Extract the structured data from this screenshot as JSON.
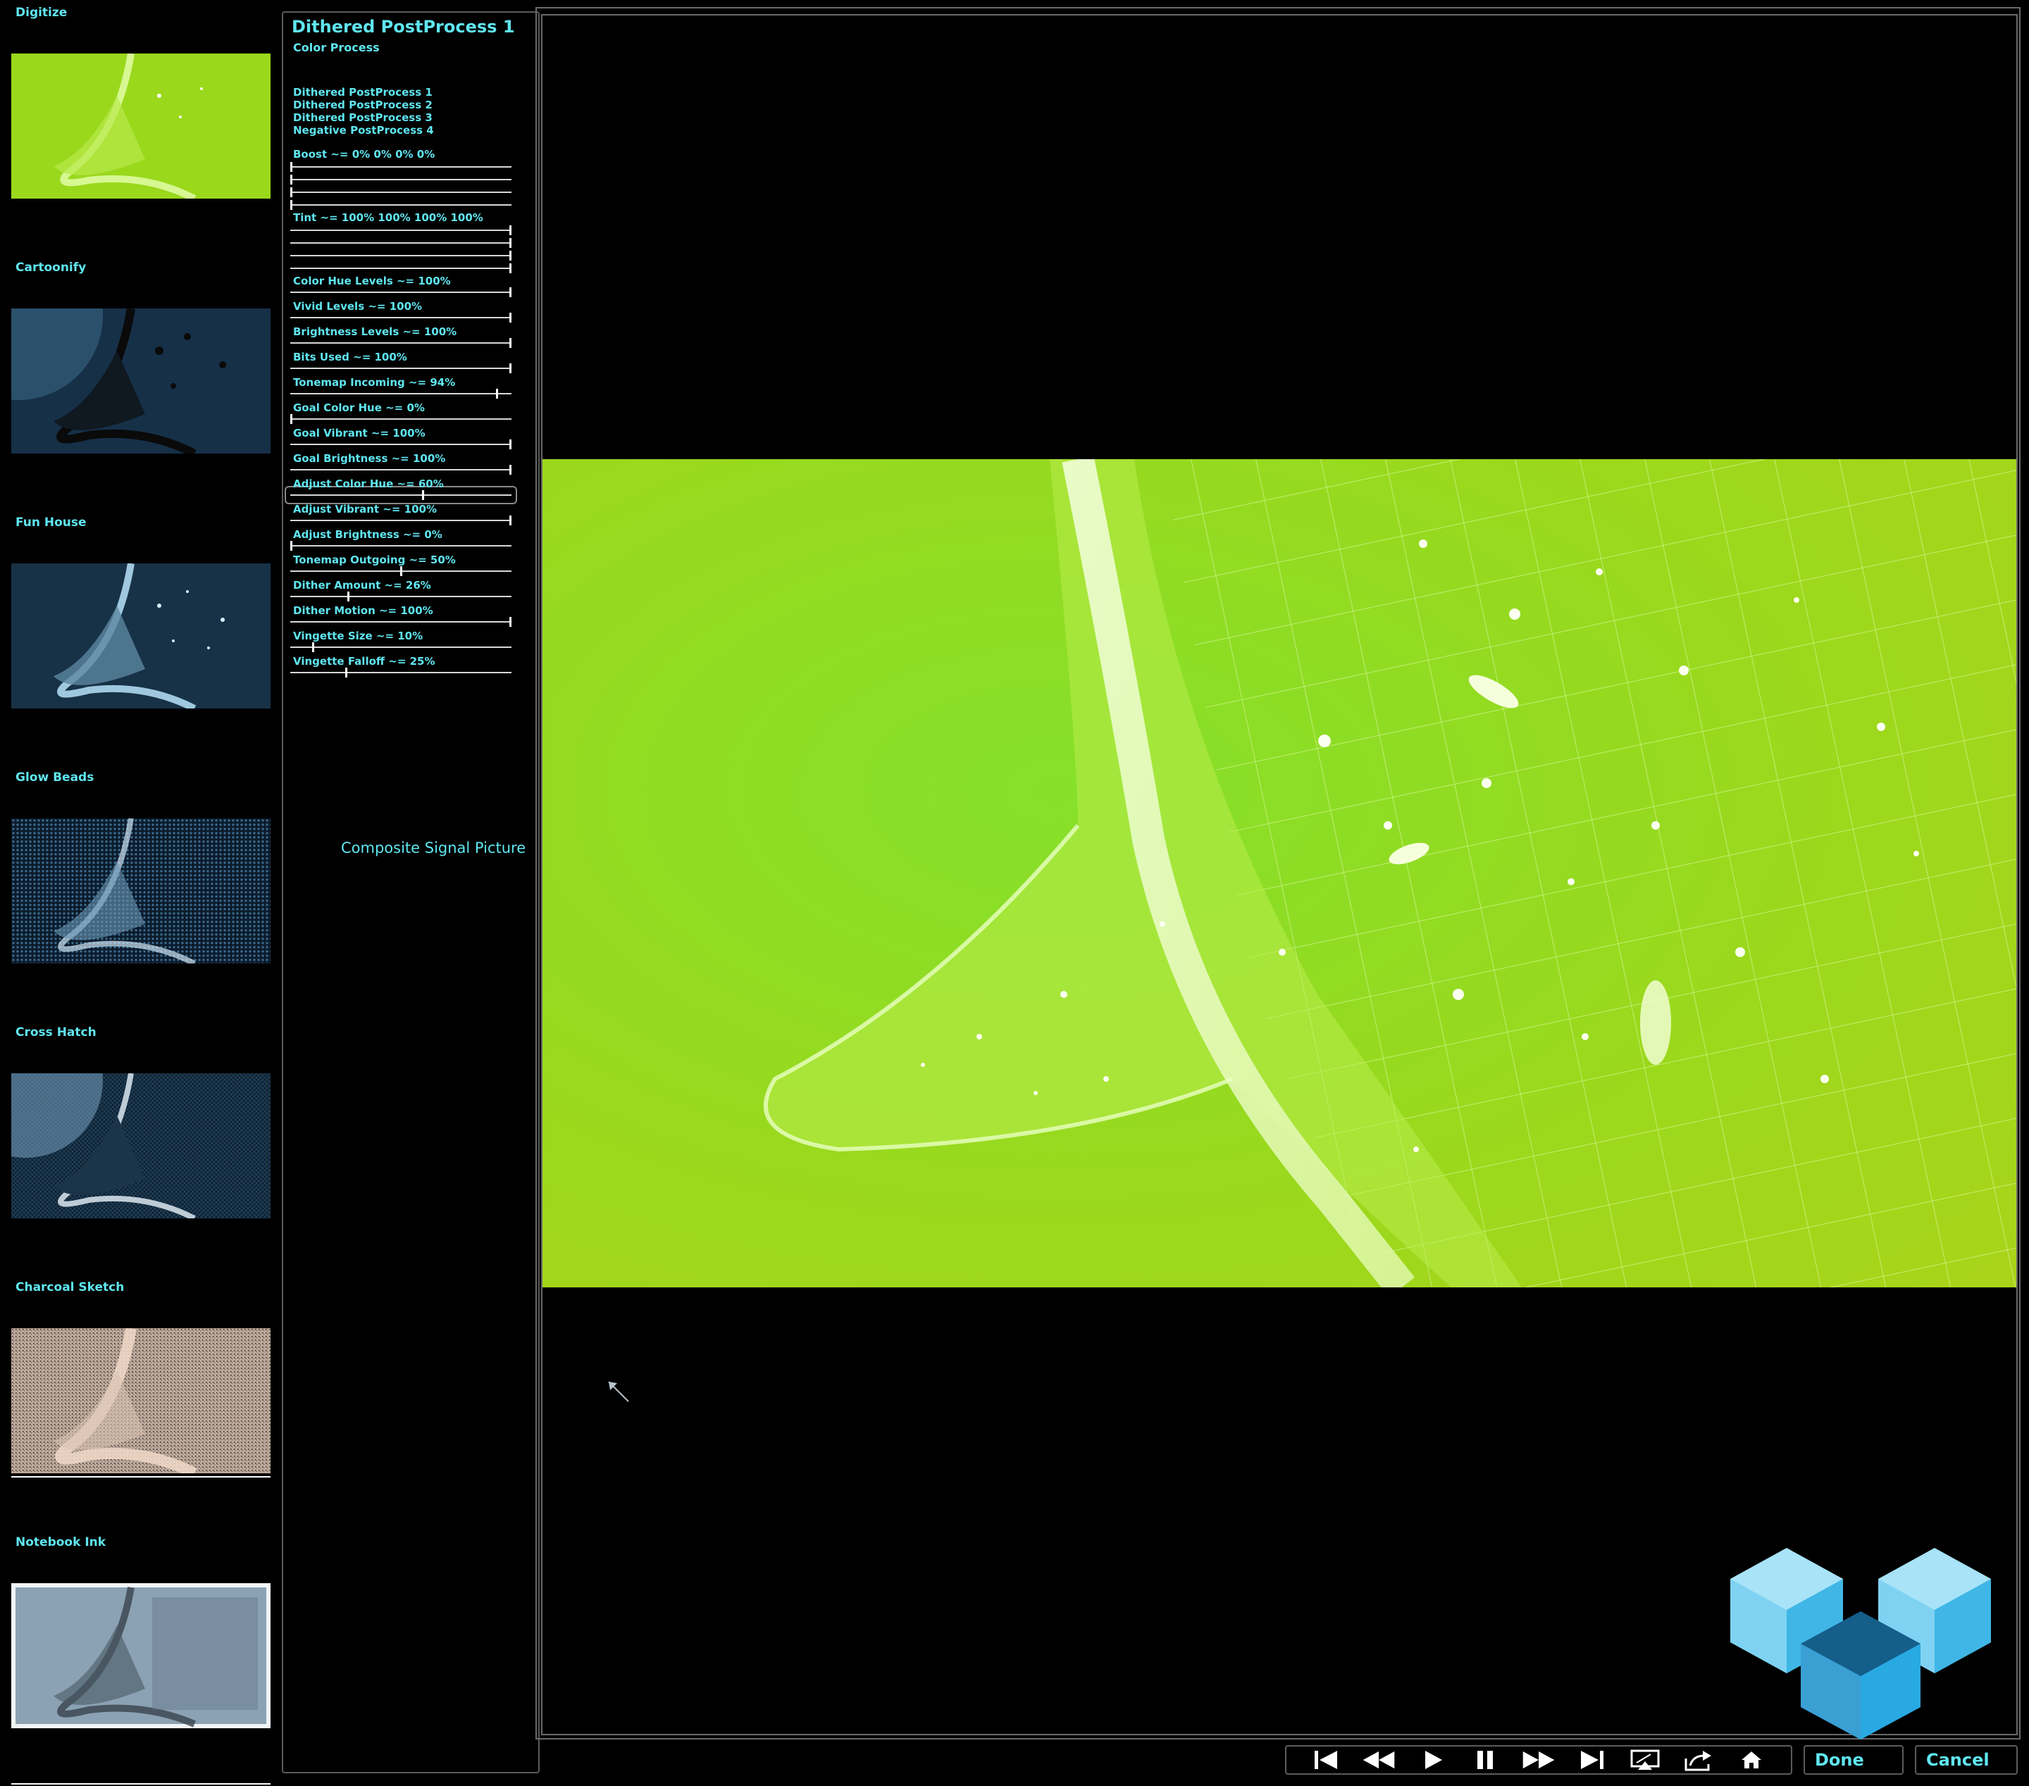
{
  "thumbnails": [
    {
      "label": "Digitize"
    },
    {
      "label": "Cartoonify"
    },
    {
      "label": "Fun House"
    },
    {
      "label": "Glow Beads"
    },
    {
      "label": "Cross Hatch"
    },
    {
      "label": "Charcoal Sketch"
    },
    {
      "label": "Notebook Ink"
    }
  ],
  "panel": {
    "title": "Dithered PostProcess 1",
    "subtitle": "Color Process",
    "presets": [
      "Dithered PostProcess 1",
      "Dithered PostProcess 2",
      "Dithered PostProcess 3",
      "Negative PostProcess 4"
    ],
    "boost_label": "Boost ~= 0% 0% 0% 0%",
    "boost_values": [
      0,
      0,
      0,
      0
    ],
    "tint_label": "Tint ~= 100% 100% 100% 100%",
    "tint_values": [
      100,
      100,
      100,
      100
    ],
    "sliders": [
      {
        "label": "Color Hue Levels ~= 100%",
        "value": 100
      },
      {
        "label": "Vivid Levels ~= 100%",
        "value": 100
      },
      {
        "label": "Brightness Levels ~= 100%",
        "value": 100
      },
      {
        "label": "Bits Used ~= 100%",
        "value": 100
      },
      {
        "label": "Tonemap Incoming ~= 94%",
        "value": 94
      },
      {
        "label": "Goal Color Hue ~= 0%",
        "value": 0
      },
      {
        "label": "Goal Vibrant ~= 100%",
        "value": 100
      },
      {
        "label": "Goal Brightness ~= 100%",
        "value": 100
      },
      {
        "label": "Adjust Color Hue ~= 60%",
        "value": 60
      },
      {
        "label": "Adjust Vibrant ~= 100%",
        "value": 100
      },
      {
        "label": "Adjust Brightness ~= 0%",
        "value": 0
      },
      {
        "label": "Tonemap Outgoing ~= 50%",
        "value": 50
      },
      {
        "label": "Dither Amount ~= 26%",
        "value": 26
      },
      {
        "label": "Dither Motion ~= 100%",
        "value": 100
      },
      {
        "label": "Vingette Size ~= 10%",
        "value": 10
      },
      {
        "label": "Vingette Falloff ~= 25%",
        "value": 25
      }
    ],
    "composite_label": "Composite Signal Picture"
  },
  "toolbar": {
    "transport_icons": [
      "skip-start-icon",
      "rewind-icon",
      "play-icon",
      "pause-icon",
      "fast-forward-icon",
      "skip-end-icon",
      "airplay-icon",
      "share-icon",
      "home-icon"
    ],
    "done_label": "Done",
    "cancel_label": "Cancel"
  },
  "colors": {
    "accent": "#5fe6f0",
    "preview_tint": "#a6e01c",
    "logo_blue": "#29a9e1"
  }
}
